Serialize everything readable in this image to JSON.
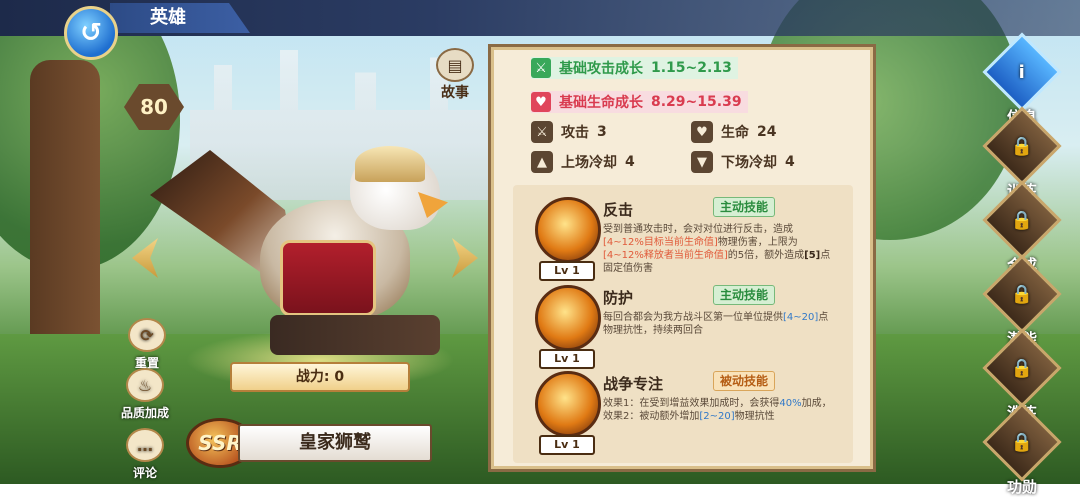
{
  "header": {
    "title": "英雄"
  },
  "hero": {
    "level": "80",
    "story_label": "故事",
    "power_label": "战力: 0",
    "rarity": "SSR",
    "name": "皇家狮鹫",
    "buttons": {
      "reset": "重置",
      "quality": "品质加成",
      "comment": "评论"
    }
  },
  "growth": {
    "attack": {
      "label": "基础攻击成长",
      "value": "1.15~2.13"
    },
    "hp": {
      "label": "基础生命成长",
      "value": "8.29~15.39"
    }
  },
  "stats": {
    "attack": {
      "label": "攻击",
      "value": "3"
    },
    "hp": {
      "label": "生命",
      "value": "24"
    },
    "cd_on": {
      "label": "上场冷却",
      "value": "4"
    },
    "cd_off": {
      "label": "下场冷却",
      "value": "4"
    }
  },
  "skills": [
    {
      "name": "反击",
      "tag": "主动技能",
      "level": "Lv 1",
      "desc_parts": [
        "受到普通攻击时，会对对位进行反击，造成",
        "[4~12%目标当前生命值]",
        "物理伤害，上限为",
        "[4~12%释放者当前生命值]",
        "的5倍，额外造成",
        "[5]",
        "点固定值伤害"
      ]
    },
    {
      "name": "防护",
      "tag": "主动技能",
      "level": "Lv 1",
      "desc_parts": [
        "每回合都会为我方战斗区第一位单位提供",
        "[4~20]",
        "点物理抗性，持续两回合"
      ]
    },
    {
      "name": "战争专注",
      "tag": "被动技能",
      "level": "Lv 1",
      "desc_parts": [
        "效果1：在受到增益效果加成时，会获得",
        "40%",
        "加成，效果2：被动额外增加",
        "[2~20]",
        "物理抗性"
      ]
    }
  ],
  "right_nav": [
    "信息",
    "训练",
    "合成",
    "潜能",
    "洗练",
    "功勋"
  ],
  "icons": {
    "back": "back-arrow-icon",
    "story": "book-icon",
    "reset": "refresh-icon",
    "quality": "flame-icon",
    "comment": "speech-bubble-icon"
  }
}
